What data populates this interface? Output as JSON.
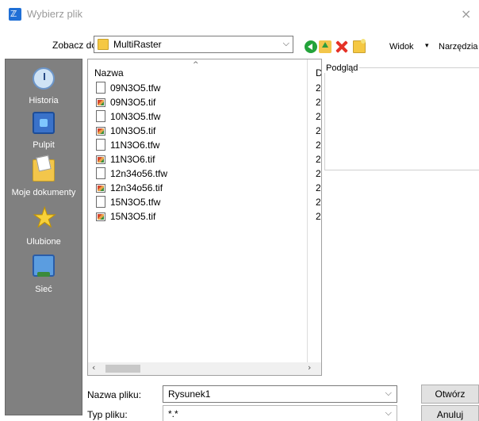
{
  "window": {
    "title": "Wybierz plik",
    "close_glyph": "×"
  },
  "toolbar": {
    "look_in_label": "Zobacz do:",
    "look_in_value": "MultiRaster",
    "view_menu": "Widok",
    "tools_menu": "Narzędzia",
    "icons": [
      "back-icon",
      "up-folder-icon",
      "delete-icon",
      "new-folder-icon"
    ]
  },
  "places": [
    {
      "label": "Historia",
      "icon": "history-icon"
    },
    {
      "label": "Pulpit",
      "icon": "desktop-icon"
    },
    {
      "label": "Moje dokumenty",
      "icon": "my-documents-icon"
    },
    {
      "label": "Ulubione",
      "icon": "favorites-star-icon"
    },
    {
      "label": "Sieć",
      "icon": "network-icon"
    }
  ],
  "file_list": {
    "columns": {
      "name": "Nazwa",
      "second": "D"
    },
    "files": [
      {
        "name": "09N3O5.tfw",
        "type": "tfw",
        "col2": "2"
      },
      {
        "name": "09N3O5.tif",
        "type": "tif",
        "col2": "2"
      },
      {
        "name": "10N3O5.tfw",
        "type": "tfw",
        "col2": "2"
      },
      {
        "name": "10N3O5.tif",
        "type": "tif",
        "col2": "2"
      },
      {
        "name": "11N3O6.tfw",
        "type": "tfw",
        "col2": "2"
      },
      {
        "name": "11N3O6.tif",
        "type": "tif",
        "col2": "2"
      },
      {
        "name": "12n34o56.tfw",
        "type": "tfw",
        "col2": "2"
      },
      {
        "name": "12n34o56.tif",
        "type": "tif",
        "col2": "2"
      },
      {
        "name": "15N3O5.tfw",
        "type": "tfw",
        "col2": "2"
      },
      {
        "name": "15N3O5.tif",
        "type": "tif",
        "col2": "2"
      }
    ]
  },
  "preview": {
    "label": "Podgląd"
  },
  "filename": {
    "label": "Nazwa pliku:",
    "value": "Rysunek1"
  },
  "filetype": {
    "label": "Typ pliku:",
    "value": "*.*"
  },
  "buttons": {
    "open": "Otwórz",
    "cancel": "Anuluj"
  }
}
